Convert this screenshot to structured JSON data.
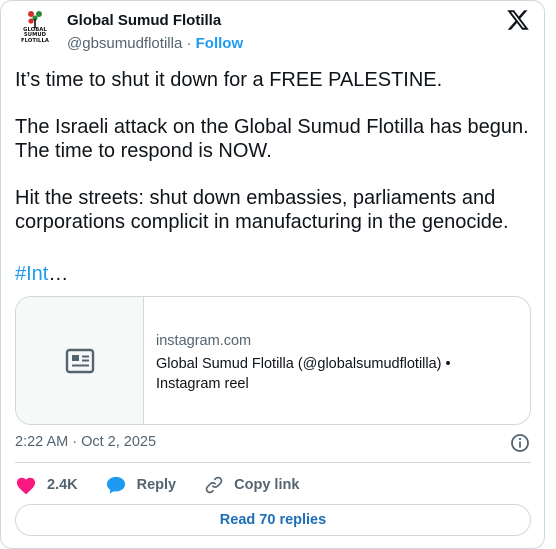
{
  "author": {
    "name": "Global Sumud Flotilla",
    "handle": "@gbsumudflotilla",
    "separator": "·",
    "follow_label": "Follow",
    "avatar_logo_text": [
      "GLOBAL",
      "SUMUD",
      "FLOTILLA"
    ]
  },
  "tweet": {
    "paragraphs": [
      [
        "It’s time to shut it down for a FREE PALESTINE."
      ],
      [
        "The Israeli attack on the Global Sumud Flotilla has begun.",
        "The time to respond is NOW."
      ],
      [
        "Hit the streets: shut down embassies, parliaments and",
        "corporations complicit in manufacturing in the genocide."
      ]
    ],
    "hashtag": "#Int",
    "truncation": "…"
  },
  "link_card": {
    "icon": "article-icon",
    "domain": "instagram.com",
    "title_line1": "Global Sumud Flotilla (@globalsumudflotilla) •",
    "title_line2": "Instagram reel"
  },
  "timestamp": "2:22 AM · Oct 2, 2025",
  "actions": {
    "likes_count": "2.4K",
    "reply_label": "Reply",
    "copy_link_label": "Copy link"
  },
  "read_replies_label": "Read 70 replies",
  "colors": {
    "accent": "#1d9bf0",
    "like": "#f91880",
    "reply_icon": "#1d9bf0",
    "text_primary": "#0f1419",
    "text_secondary": "#536471",
    "border": "#cfd9de"
  }
}
